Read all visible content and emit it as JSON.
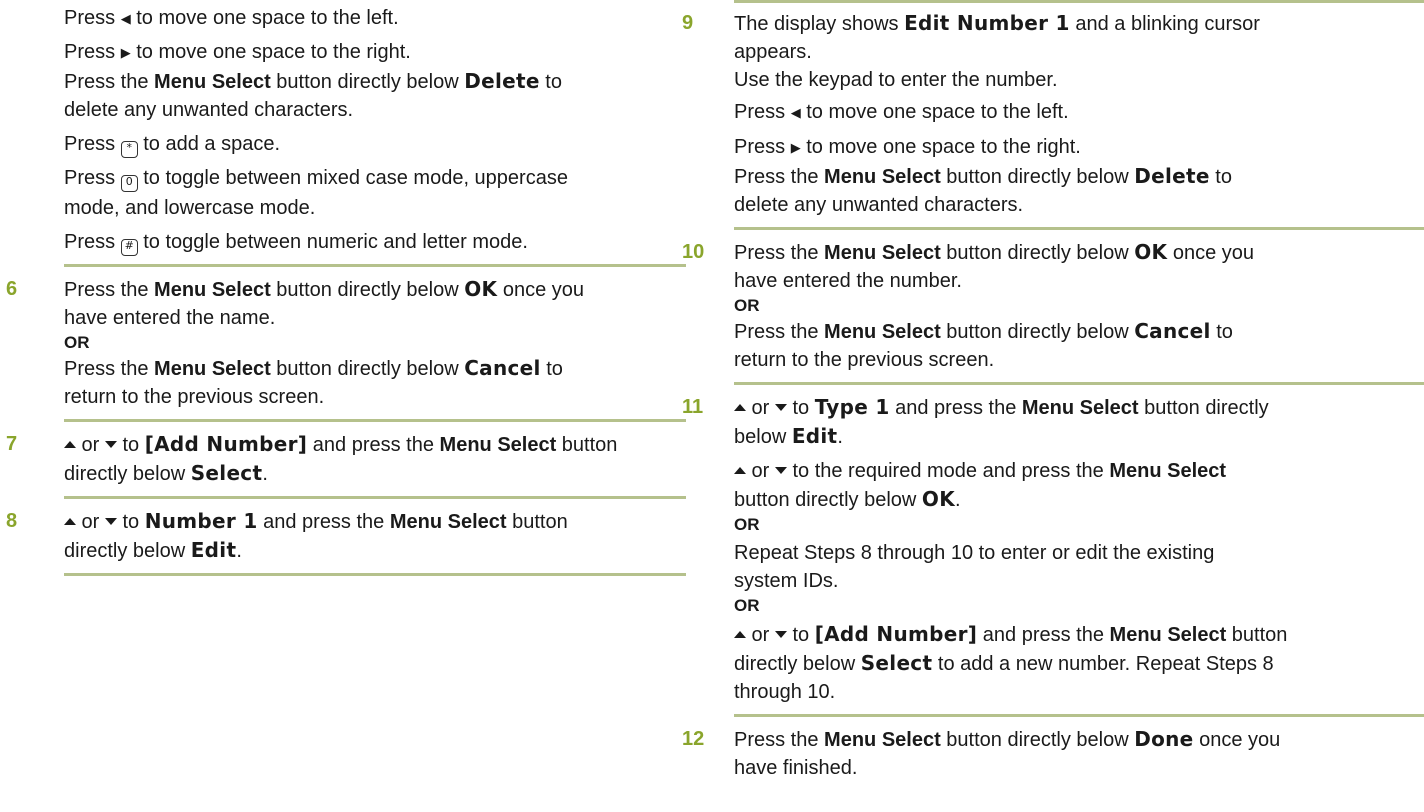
{
  "left": {
    "intro": {
      "l1a": "Press ",
      "l1b": " to move one space to the left.",
      "l2a": "Press ",
      "l2b": " to move one space to the right.",
      "l3a": "Press the ",
      "l3b": "Menu Select",
      "l3c": " button directly below ",
      "l3d": "Delete",
      "l3e": " to",
      "l4": "delete any unwanted characters.",
      "l5a": "Press ",
      "l5b": " to add a space.",
      "l6a": "Press ",
      "l6b": " to toggle between mixed case mode, uppercase",
      "l7": "mode, and lowercase mode.",
      "l8a": "Press ",
      "l8b": " to toggle between numeric and letter mode."
    },
    "step6": {
      "num": "6",
      "a": "Press the ",
      "b": "Menu Select",
      "c": " button directly below ",
      "d": "OK",
      "e": " once you",
      "f": "have entered the name.",
      "or": "OR",
      "g": "Press the ",
      "h": "Menu Select",
      "i": " button directly below ",
      "j": "Cancel",
      "k": " to",
      "l": "return to the previous screen."
    },
    "step7": {
      "num": "7",
      "a": " or ",
      "b": " to ",
      "c": "[Add Number]",
      "d": " and press the ",
      "e": "Menu Select",
      "f": " button",
      "g": "directly below ",
      "h": "Select",
      "i": "."
    },
    "step8": {
      "num": "8",
      "a": " or ",
      "b": " to ",
      "c": "Number 1",
      "d": " and press the ",
      "e": "Menu Select",
      "f": " button",
      "g": "directly below ",
      "h": "Edit",
      "i": "."
    }
  },
  "right": {
    "step9": {
      "num": "9",
      "a": "The display shows ",
      "b": "Edit Number 1",
      "c": " and a blinking cursor",
      "d": "appears.",
      "e": "Use the keypad to enter the number.",
      "f1": "Press ",
      "f2": " to move one space to the left.",
      "g1": "Press ",
      "g2": " to move one space to the right.",
      "h": "Press the ",
      "i": "Menu Select",
      "j": " button directly below ",
      "k": "Delete",
      "l": " to",
      "m": "delete any unwanted characters."
    },
    "step10": {
      "num": "10",
      "a": "Press the ",
      "b": "Menu Select",
      "c": " button directly below ",
      "d": "OK",
      "e": " once you",
      "f": "have entered the number.",
      "or": "OR",
      "g": "Press the ",
      "h": "Menu Select",
      "i": " button directly below ",
      "j": "Cancel",
      "k": " to",
      "l": "return to the previous screen."
    },
    "step11": {
      "num": "11",
      "a": " or ",
      "b": " to ",
      "c": "Type 1",
      "d": " and press the ",
      "e": "Menu Select",
      "f": " button directly",
      "g": "below ",
      "h": "Edit",
      "i": ".",
      "j": " or ",
      "k": " to the required mode and press the ",
      "l": "Menu Select",
      "m": "button directly below ",
      "n": "OK",
      "o": ".",
      "or1": "OR",
      "p": "Repeat Steps 8 through 10 to enter or edit the existing",
      "q": "system IDs.",
      "or2": "OR",
      "r": " or ",
      "s": " to ",
      "t": "[Add Number]",
      "u": " and press the ",
      "v": "Menu Select",
      "w": " button",
      "x": "directly below ",
      "y": "Select",
      "z": " to add a new number. Repeat Steps 8",
      "aa": "through 10."
    },
    "step12": {
      "num": "12",
      "a": "Press the ",
      "b": "Menu Select",
      "c": " button directly below ",
      "d": "Done",
      "e": " once you",
      "f": "have finished."
    }
  },
  "icons": {
    "left_arrow": "left-arrow-key-icon",
    "right_arrow": "right-arrow-key-icon",
    "up_arrow": "up-arrow-icon",
    "down_arrow": "down-arrow-icon",
    "star_key": "star-key-icon",
    "zero_key": "zero-key-icon",
    "hash_key": "hash-key-icon"
  },
  "colors": {
    "step_number": "#8aa52c",
    "rule": "#b5c18c"
  }
}
